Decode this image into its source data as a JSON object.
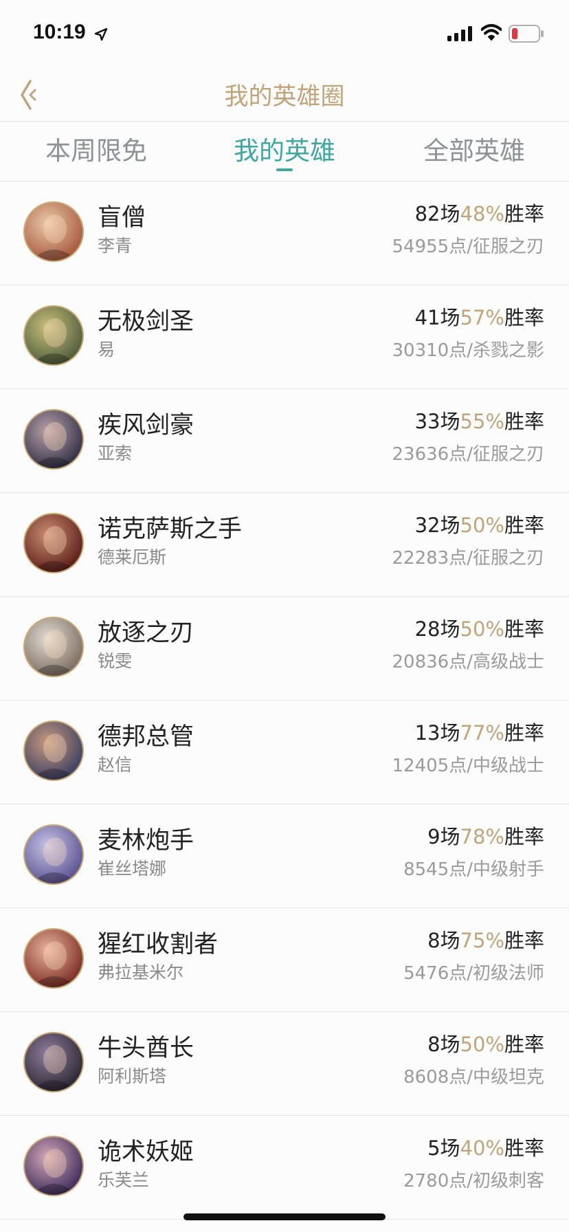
{
  "status_bar": {
    "time": "10:19"
  },
  "header": {
    "title": "我的英雄圈"
  },
  "tabs": [
    {
      "label": "本周限免"
    },
    {
      "label": "我的英雄"
    },
    {
      "label": "全部英雄"
    }
  ],
  "heroes": [
    {
      "title": "盲僧",
      "name": "李青",
      "games": "82场",
      "rate": "48%",
      "rate_label": "胜率",
      "points": "54955点/征服之刃",
      "avatar_colors": [
        "#e8c9a8",
        "#a6563c"
      ]
    },
    {
      "title": "无极剑圣",
      "name": "易",
      "games": "41场",
      "rate": "57%",
      "rate_label": "胜率",
      "points": "30310点/杀戮之影",
      "avatar_colors": [
        "#c9c07a",
        "#4c5a3c"
      ]
    },
    {
      "title": "疾风剑豪",
      "name": "亚索",
      "games": "33场",
      "rate": "55%",
      "rate_label": "胜率",
      "points": "23636点/征服之刃",
      "avatar_colors": [
        "#b9a2a8",
        "#2e2d45"
      ]
    },
    {
      "title": "诺克萨斯之手",
      "name": "德莱厄斯",
      "games": "32场",
      "rate": "50%",
      "rate_label": "胜率",
      "points": "22283点/征服之刃",
      "avatar_colors": [
        "#c98e71",
        "#5a1b17"
      ]
    },
    {
      "title": "放逐之刃",
      "name": "锐雯",
      "games": "28场",
      "rate": "50%",
      "rate_label": "胜率",
      "points": "20836点/高级战士",
      "avatar_colors": [
        "#e2dcd4",
        "#7a6a5e"
      ]
    },
    {
      "title": "德邦总管",
      "name": "赵信",
      "games": "13场",
      "rate": "77%",
      "rate_label": "胜率",
      "points": "12405点/中级战士",
      "avatar_colors": [
        "#c69a7c",
        "#3a3d63"
      ]
    },
    {
      "title": "麦林炮手",
      "name": "崔丝塔娜",
      "games": "9场",
      "rate": "78%",
      "rate_label": "胜率",
      "points": "8545点/中级射手",
      "avatar_colors": [
        "#c6c3e6",
        "#59508f"
      ]
    },
    {
      "title": "猩红收割者",
      "name": "弗拉基米尔",
      "games": "8场",
      "rate": "75%",
      "rate_label": "胜率",
      "points": "5476点/初级法师",
      "avatar_colors": [
        "#e8b39c",
        "#7a2a22"
      ]
    },
    {
      "title": "牛头酋长",
      "name": "阿利斯塔",
      "games": "8场",
      "rate": "50%",
      "rate_label": "胜率",
      "points": "8608点/中级坦克",
      "avatar_colors": [
        "#8e7e9e",
        "#2a2530"
      ]
    },
    {
      "title": "诡术妖姬",
      "name": "乐芙兰",
      "games": "5场",
      "rate": "40%",
      "rate_label": "胜率",
      "points": "2780点/初级刺客",
      "avatar_colors": [
        "#d6a8b8",
        "#3a2a5a"
      ]
    }
  ],
  "colors": {
    "accent_gold": "#c0a47a",
    "accent_teal": "#3fa7a0",
    "battery_low": "#e0383e"
  },
  "icons": [
    "location-arrow-icon",
    "signal-icon",
    "wifi-icon",
    "battery-icon",
    "back-icon"
  ]
}
